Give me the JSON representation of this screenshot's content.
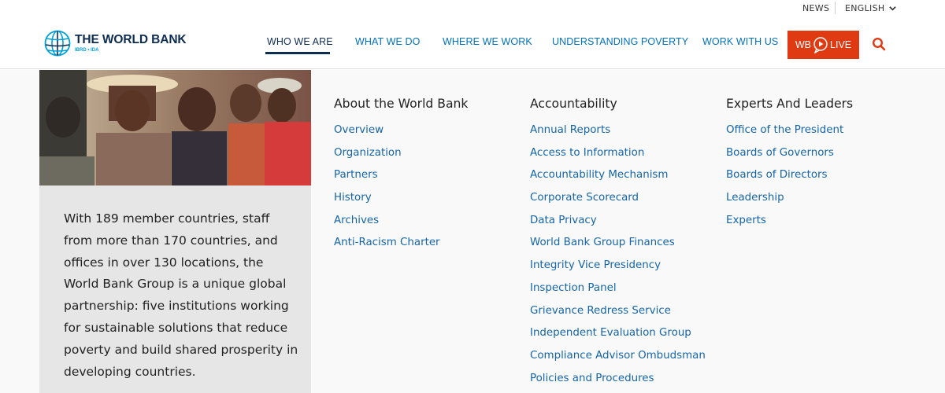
{
  "utility": {
    "news_label": "NEWS",
    "language_label": "ENGLISH"
  },
  "header": {
    "logo_title": "THE WORLD BANK",
    "logo_subtitle": "IBRD • IDA",
    "nav": [
      {
        "label": "WHO WE ARE",
        "active": true
      },
      {
        "label": "WHAT WE DO"
      },
      {
        "label": "WHERE WE WORK"
      },
      {
        "label": "UNDERSTANDING POVERTY"
      },
      {
        "label": "WORK WITH US"
      }
    ],
    "live_prefix": "WB",
    "live_suffix": "LIVE",
    "accent_color": "#e03a12",
    "brand_color": "#0d2c52",
    "link_color": "#0071bc"
  },
  "panel": {
    "intro": "With 189 member countries, staff from more than 170 countries, and offices in over 130 locations, the World Bank Group is a unique global partnership: five institutions working for sustainable solutions that reduce poverty and build shared prosperity in developing countries.",
    "columns": [
      {
        "heading": "About the World Bank",
        "links": [
          "Overview",
          "Organization",
          "Partners",
          "History",
          "Archives",
          "Anti-Racism Charter"
        ]
      },
      {
        "heading": "Accountability",
        "links": [
          "Annual Reports",
          "Access to Information",
          "Accountability Mechanism",
          "Corporate Scorecard",
          "Data Privacy",
          "World Bank Group Finances",
          "Integrity Vice Presidency",
          "Inspection Panel",
          "Grievance Redress Service",
          "Independent Evaluation Group",
          "Compliance Advisor Ombudsman",
          "Policies and Procedures"
        ]
      },
      {
        "heading": "Experts And Leaders",
        "links": [
          "Office of the President",
          "Boards of Governors",
          "Boards of Directors",
          "Leadership",
          "Experts"
        ]
      }
    ]
  }
}
